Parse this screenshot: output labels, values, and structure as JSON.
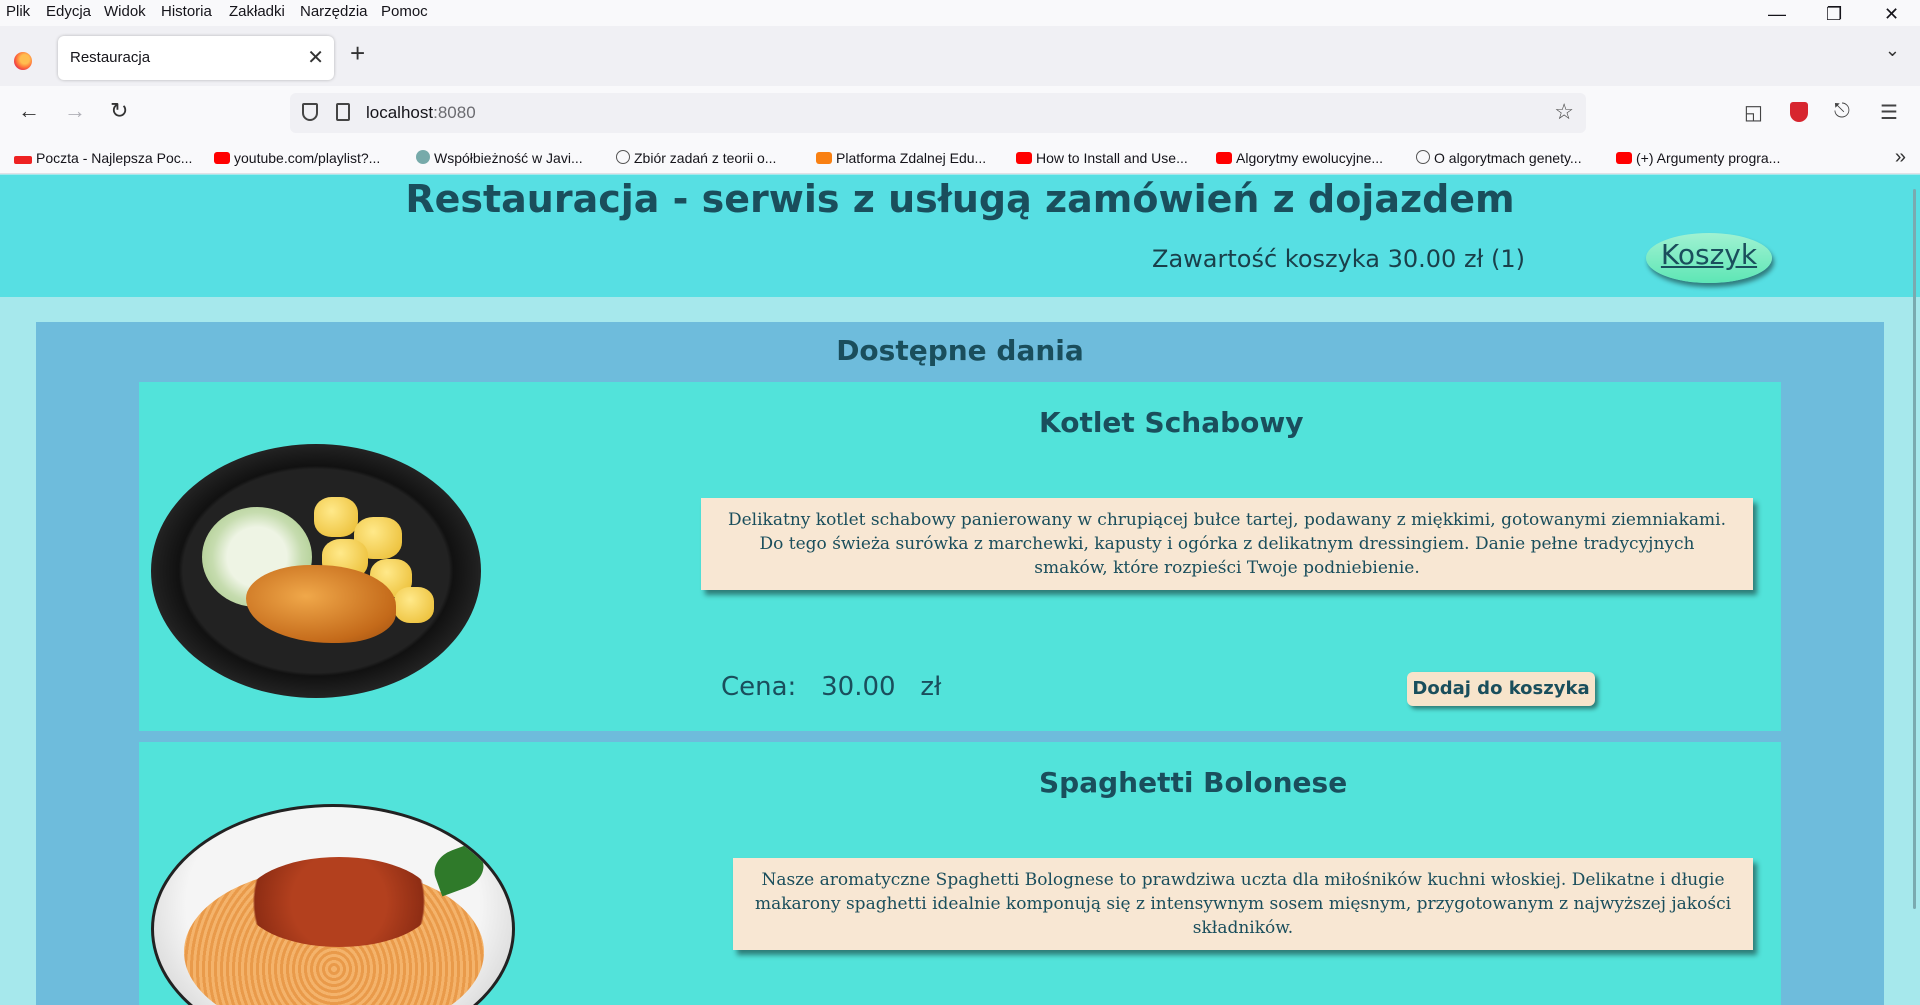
{
  "browser": {
    "menu": [
      "Plik",
      "Edycja",
      "Widok",
      "Historia",
      "Zakładki",
      "Narzędzia",
      "Pomoc"
    ],
    "tab_title": "Restauracja",
    "url_host": "localhost",
    "url_port": ":8080",
    "bookmarks": [
      {
        "label": "Poczta - Najlepsza Poc...",
        "icon": "wp-icon"
      },
      {
        "label": "youtube.com/playlist?...",
        "icon": "youtube-icon"
      },
      {
        "label": "Współbieżność w Javi...",
        "icon": "java-icon"
      },
      {
        "label": "Zbiór zadań z teorii o...",
        "icon": "globe-icon"
      },
      {
        "label": "Platforma Zdalnej Edu...",
        "icon": "moodle-icon"
      },
      {
        "label": "How to Install and Use...",
        "icon": "youtube-icon"
      },
      {
        "label": "Algorytmy ewolucyjne...",
        "icon": "youtube-icon"
      },
      {
        "label": "O algorytmach genety...",
        "icon": "globe-icon"
      },
      {
        "label": "(+) Argumenty progra...",
        "icon": "youtube-icon"
      }
    ]
  },
  "header": {
    "title": "Restauracja - serwis z usługą zamówień z dojazdem",
    "cart_summary": "Zawartość koszyka 30.00 zł (1)",
    "cart_button": "Koszyk"
  },
  "menu_section": {
    "title": "Dostępne dania",
    "dishes": [
      {
        "name": "Kotlet Schabowy",
        "description": "Delikatny kotlet schabowy panierowany w chrupiącej bułce tartej, podawany z miękkimi, gotowanymi ziemniakami. Do tego świeża surówka z marchewki, kapusty i ogórka z delikatnym dressingiem. Danie pełne tradycyjnych smaków, które rozpieści Twoje podniebienie.",
        "price_label": "Cena:",
        "price": "30.00",
        "currency": "zł",
        "add_button": "Dodaj do koszyka"
      },
      {
        "name": "Spaghetti Bolonese",
        "description": "Nasze aromatyczne Spaghetti Bolognese to prawdziwa uczta dla miłośników kuchni włoskiej. Delikatne i długie makarony spaghetti idealnie komponują się z intensywnym sosem mięsnym, przygotowanym z najwyższej jakości składników."
      }
    ]
  }
}
